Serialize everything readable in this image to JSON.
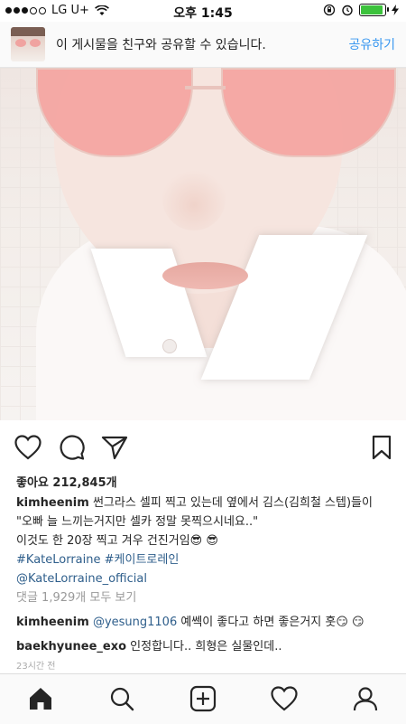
{
  "status_bar": {
    "carrier": "LG U+",
    "time": "오후 1:45"
  },
  "share_banner": {
    "text": "이 게시물을 친구와 공유할 수 있습니다.",
    "action": "공유하기"
  },
  "post": {
    "likes": "좋아요 212,845개",
    "caption": {
      "username": "kimheenim",
      "line1": "썬그라스 셀피 찍고 있는데 옆에서 김스(김희철 스텝)들이",
      "line2": "\"오빠 늘 느끼는거지만 셀카 정말 못찍으시네요..\"",
      "line3": "이것도 한 20장 찍고 겨우 건진거임😎 😎",
      "hashtags": "#KateLorraine #케이트로레인",
      "mention": "@KateLorraine_official"
    },
    "view_comments": "댓글 1,929개 모두 보기",
    "comments": [
      {
        "username": "kimheenim",
        "mention": "@yesung1106",
        "text": " 예쎅이 좋다고 하면 좋은거지 훗😏 😏"
      },
      {
        "username": "baekhyunee_exo",
        "mention": "",
        "text": " 인정합니다.. 희형은 실물인데.."
      }
    ],
    "timestamp": "23시간 전"
  },
  "icons": {
    "like": "heart-icon",
    "comment": "comment-icon",
    "share": "send-icon",
    "save": "bookmark-icon",
    "tabs": [
      "home-icon",
      "search-icon",
      "add-icon",
      "activity-heart-icon",
      "profile-icon"
    ]
  },
  "colors": {
    "link": "#3897f0",
    "hashtag": "#2e5e8b",
    "battery": "#3cc23c"
  }
}
